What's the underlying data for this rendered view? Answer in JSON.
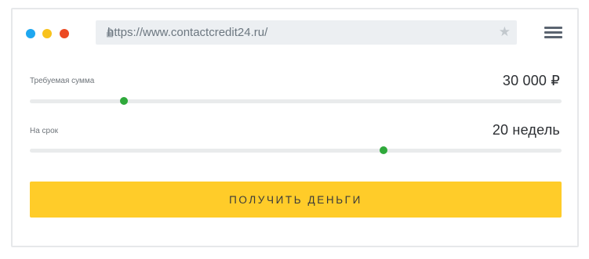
{
  "browser": {
    "window_controls": [
      "close",
      "minimize",
      "maximize"
    ],
    "url": "https://www.contactcredit24.ru/",
    "icons": {
      "lock": "lock-icon",
      "bookmark": "star-icon",
      "menu": "hamburger-menu-icon"
    },
    "colors": {
      "close": "#ec4a23",
      "minimize": "#f8c21c",
      "maximize": "#1ea7f0"
    }
  },
  "calculator": {
    "amount": {
      "label": "Требуемая сумма",
      "value": "30 000 ₽",
      "slider_fraction": 0.177
    },
    "term": {
      "label": "На срок",
      "value": "20 недель",
      "slider_fraction": 0.665
    },
    "submit_label": "ПОЛУЧИТЬ ДЕНЬГИ"
  },
  "colors": {
    "accent": "#ffcc29",
    "slider_thumb": "#2fa93b",
    "track": "#e9ebec"
  }
}
